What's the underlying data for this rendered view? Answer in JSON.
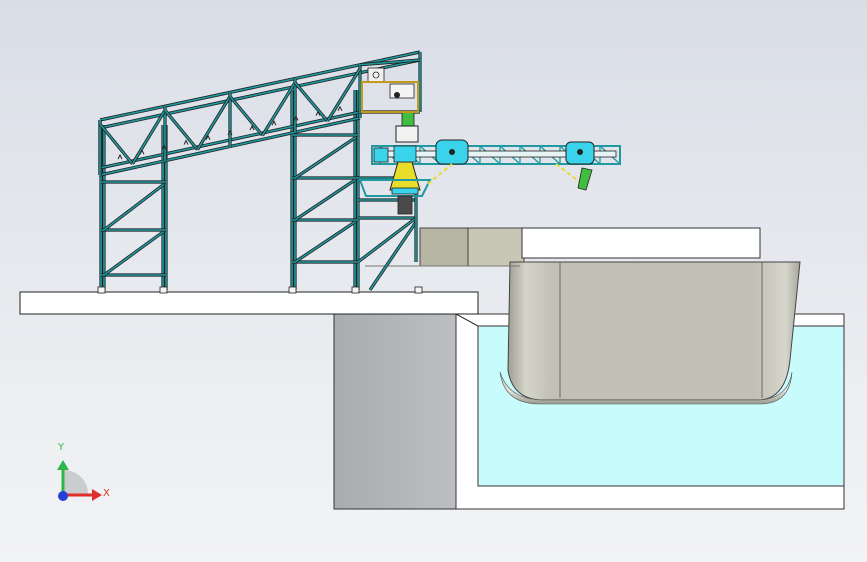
{
  "triad": {
    "y_label": "Y",
    "x_label": "X",
    "y_color": "#2fb64a",
    "x_color": "#e0302b",
    "z_color": "#2440d8"
  },
  "colors": {
    "structure": "#1f9aa0",
    "conveyor_parts": "#39d3ec",
    "hopper": "#e8dd2a",
    "spout": "#3fbe3f",
    "hull": "#c2c2b4",
    "water": "#c8fbfc",
    "ground": "#ffffff",
    "wall": "#b4b7b9"
  }
}
